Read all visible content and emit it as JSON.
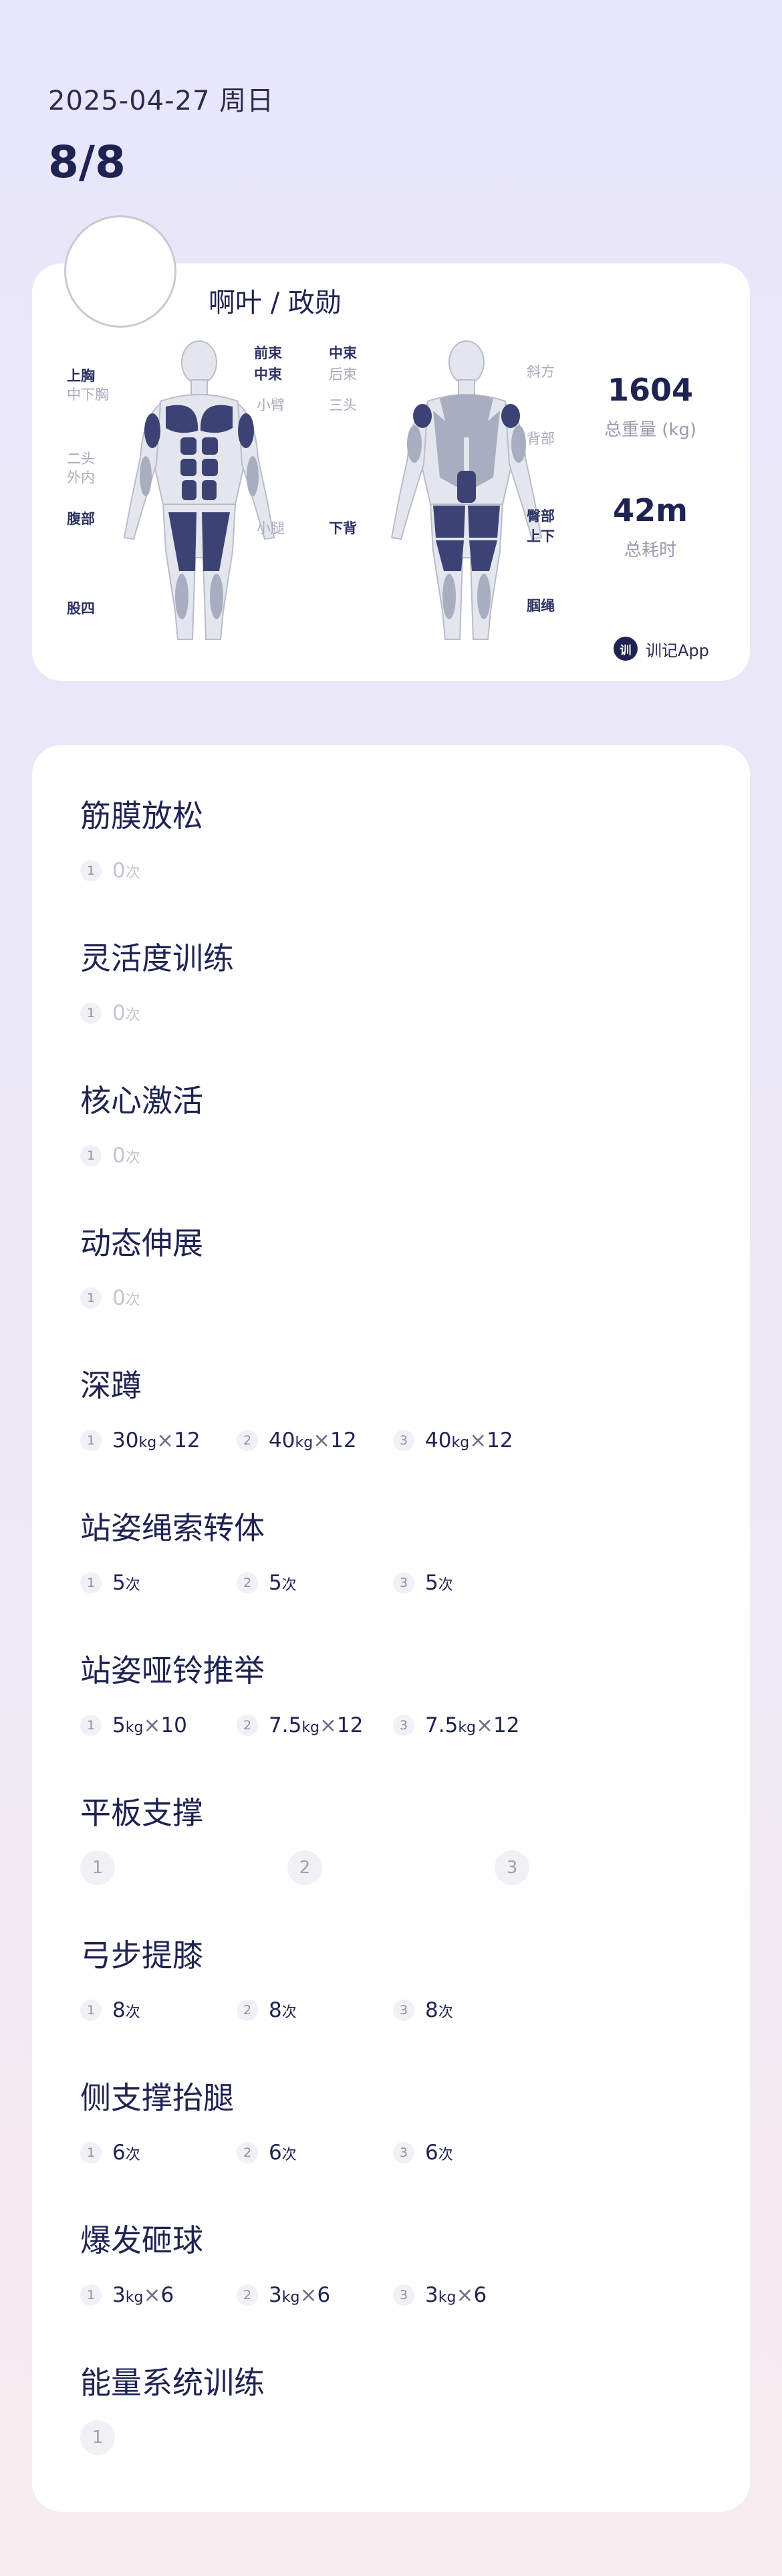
{
  "header": {
    "date": "2025-04-27 周日",
    "count": "8/8"
  },
  "summary": {
    "user_name": "啊叶 / 政勋",
    "front_labels": {
      "chest_upper": "上胸",
      "chest_mid": "中下胸",
      "biceps": "二头",
      "forearm": "外内",
      "abs": "腹部",
      "quads": "股四",
      "delt_front": "前束",
      "delt_mid": "中束",
      "small_arm": "小臂",
      "calf": "小腿"
    },
    "back_labels": {
      "delt_mid": "中束",
      "delt_rear": "后束",
      "triceps": "三头",
      "lower_back": "下背",
      "trapezius": "斜方",
      "back": "背部",
      "glutes": "臀部",
      "glute_sub": "上下",
      "hamstrings": "腘绳"
    },
    "total_weight_value": "1604",
    "total_weight_label": "总重量 (kg)",
    "duration_value": "42m",
    "duration_label": "总耗时",
    "brand": "训记App",
    "brand_logo_text": "训",
    "active_color": "#3d4274",
    "inactive_color": "#a8adbf"
  },
  "exercises": [
    {
      "name": "筋膜放松",
      "sets": [
        {
          "n": "1",
          "reps": "0",
          "rep_unit": "次"
        }
      ]
    },
    {
      "name": "灵活度训练",
      "sets": [
        {
          "n": "1",
          "reps": "0",
          "rep_unit": "次"
        }
      ]
    },
    {
      "name": "核心激活",
      "sets": [
        {
          "n": "1",
          "reps": "0",
          "rep_unit": "次"
        }
      ]
    },
    {
      "name": "动态伸展",
      "sets": [
        {
          "n": "1",
          "reps": "0",
          "rep_unit": "次"
        }
      ]
    },
    {
      "name": "深蹲",
      "sets": [
        {
          "n": "1",
          "weight": "30",
          "unit": "kg",
          "x": "×",
          "reps": "12"
        },
        {
          "n": "2",
          "weight": "40",
          "unit": "kg",
          "x": "×",
          "reps": "12"
        },
        {
          "n": "3",
          "weight": "40",
          "unit": "kg",
          "x": "×",
          "reps": "12"
        }
      ]
    },
    {
      "name": "站姿绳索转体",
      "sets": [
        {
          "n": "1",
          "reps": "5",
          "rep_unit": "次"
        },
        {
          "n": "2",
          "reps": "5",
          "rep_unit": "次"
        },
        {
          "n": "3",
          "reps": "5",
          "rep_unit": "次"
        }
      ]
    },
    {
      "name": "站姿哑铃推举",
      "sets": [
        {
          "n": "1",
          "weight": "5",
          "unit": "kg",
          "x": "×",
          "reps": "10"
        },
        {
          "n": "2",
          "weight": "7.5",
          "unit": "kg",
          "x": "×",
          "reps": "12"
        },
        {
          "n": "3",
          "weight": "7.5",
          "unit": "kg",
          "x": "×",
          "reps": "12"
        }
      ]
    },
    {
      "name": "平板支撑",
      "sets": [
        {
          "n": "1"
        },
        {
          "n": "2"
        },
        {
          "n": "3"
        }
      ]
    },
    {
      "name": "弓步提膝",
      "sets": [
        {
          "n": "1",
          "reps": "8",
          "rep_unit": "次"
        },
        {
          "n": "2",
          "reps": "8",
          "rep_unit": "次"
        },
        {
          "n": "3",
          "reps": "8",
          "rep_unit": "次"
        }
      ]
    },
    {
      "name": "侧支撑抬腿",
      "sets": [
        {
          "n": "1",
          "reps": "6",
          "rep_unit": "次"
        },
        {
          "n": "2",
          "reps": "6",
          "rep_unit": "次"
        },
        {
          "n": "3",
          "reps": "6",
          "rep_unit": "次"
        }
      ]
    },
    {
      "name": "爆发砸球",
      "sets": [
        {
          "n": "1",
          "weight": "3",
          "unit": "kg",
          "x": "×",
          "reps": "6"
        },
        {
          "n": "2",
          "weight": "3",
          "unit": "kg",
          "x": "×",
          "reps": "6"
        },
        {
          "n": "3",
          "weight": "3",
          "unit": "kg",
          "x": "×",
          "reps": "6"
        }
      ]
    },
    {
      "name": "能量系统训练",
      "sets": [
        {
          "n": "1"
        }
      ]
    }
  ]
}
